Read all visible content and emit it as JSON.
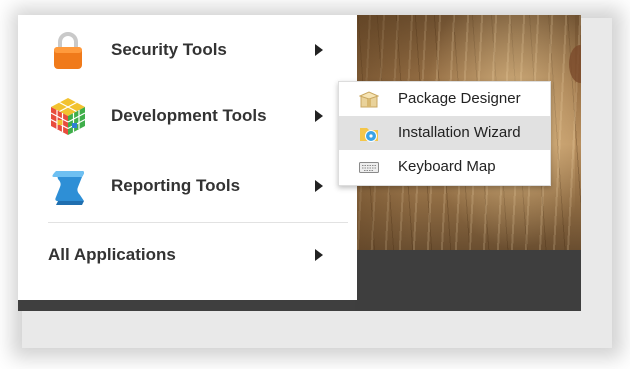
{
  "main_menu": {
    "items": [
      {
        "label": "Security Tools",
        "icon": "padlock-icon",
        "has_submenu": true
      },
      {
        "label": "Development Tools",
        "icon": "rubiks-cube-icon",
        "has_submenu": true,
        "open": true
      },
      {
        "label": "Reporting Tools",
        "icon": "scroll-icon",
        "has_submenu": true
      }
    ],
    "all_applications": {
      "label": "All Applications",
      "has_submenu": true
    }
  },
  "submenu": {
    "parent": "Development Tools",
    "items": [
      {
        "label": "Package Designer",
        "icon": "package-box-icon"
      },
      {
        "label": "Installation Wizard",
        "icon": "install-disc-icon",
        "highlighted": true
      },
      {
        "label": "Keyboard Map",
        "icon": "keyboard-icon"
      }
    ]
  },
  "colors": {
    "menu_background": "#ffffff",
    "highlight": "#e1e1e1",
    "text": "#333333",
    "taskbar": "#3e3e3e",
    "padlock_orange": "#f07a1a",
    "scroll_blue": "#2e8fd6"
  }
}
